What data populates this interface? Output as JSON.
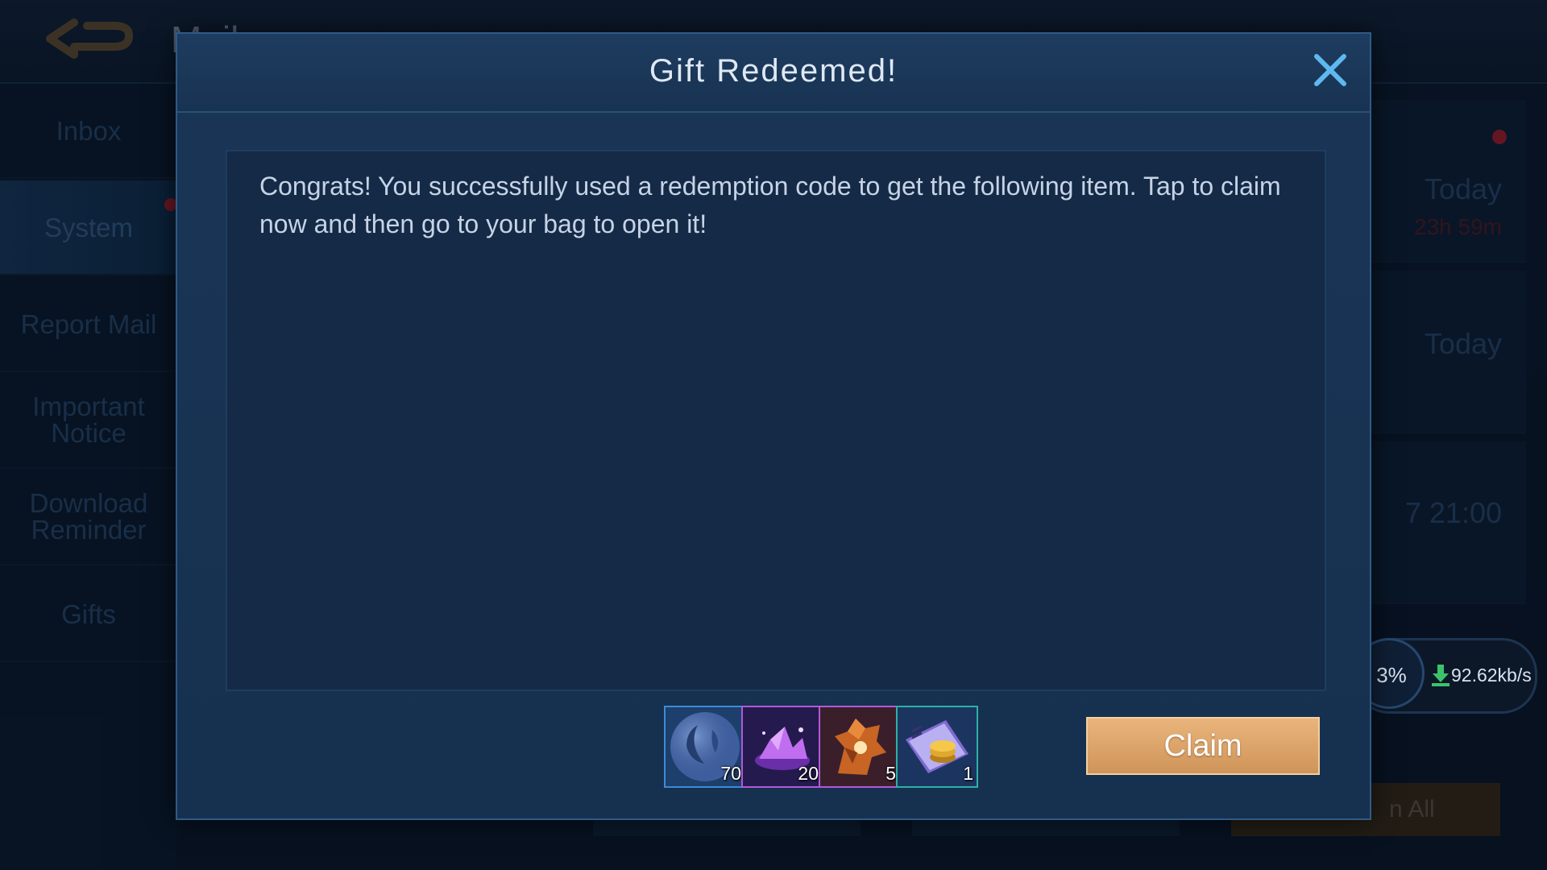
{
  "background": {
    "screen_title": "Mail",
    "sidebar": {
      "items": [
        {
          "label": "Inbox"
        },
        {
          "label": "System"
        },
        {
          "label": "Report Mail"
        },
        {
          "label": "Important Notice"
        },
        {
          "label": "Download Reminder"
        },
        {
          "label": "Gifts"
        }
      ]
    },
    "mail_list": [
      {
        "date": "Today",
        "time": "23h 59m"
      },
      {
        "date": "Today"
      },
      {
        "date": "7 21:00"
      }
    ],
    "claim_all_label": "n All"
  },
  "download": {
    "percent": "3%",
    "speed": "92.62kb/s"
  },
  "modal": {
    "title": "Gift Redeemed!",
    "message": "Congrats! You successfully used a redemption code to get the following item. Tap to claim now and then go to your bag to open it!",
    "items": [
      {
        "icon": "moon-emblem-icon",
        "quantity": "70"
      },
      {
        "icon": "purple-crystal-icon",
        "quantity": "20"
      },
      {
        "icon": "hero-fragment-icon",
        "quantity": "5"
      },
      {
        "icon": "gold-coin-card-icon",
        "quantity": "1"
      }
    ],
    "claim_label": "Claim"
  },
  "colors": {
    "modal_bg": "#16304f",
    "claim_button": "#d99e62",
    "close_icon": "#5fb8f0"
  }
}
